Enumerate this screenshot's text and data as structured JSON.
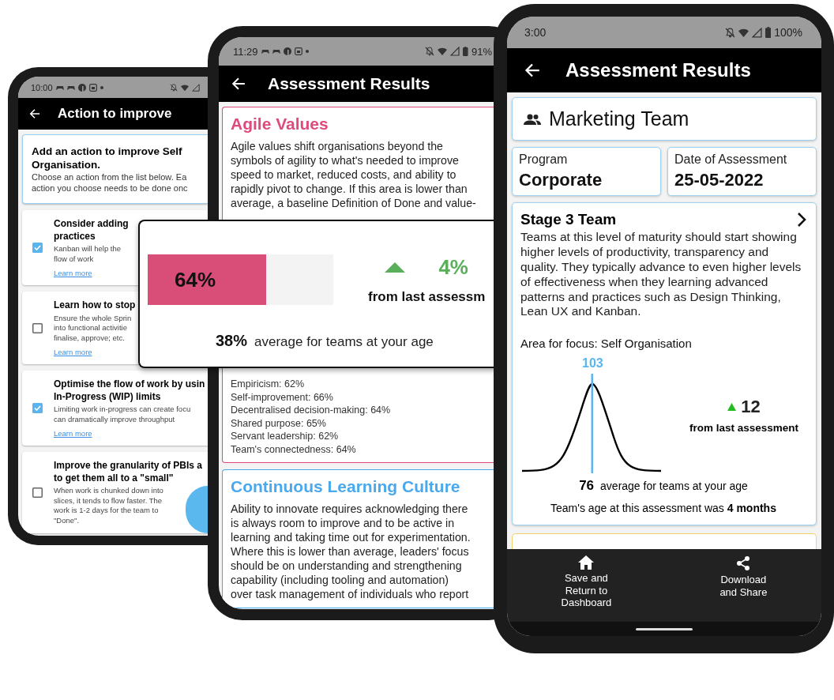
{
  "action_screen": {
    "status_bar": {
      "time": "10:00"
    },
    "title": "Action to improve",
    "intro": {
      "heading": "Add an action to improve Self\nOrganisation.",
      "text": "Choose an action from the list below. Ea\naction you choose needs to be done onc"
    },
    "actions": [
      {
        "title": "Consider adding\npractices",
        "text": "Kanban will help the\nflow of work",
        "link": "Learn more",
        "checked": true
      },
      {
        "title": "Learn how to stop",
        "text": "Ensure the whole Sprin\ninto functional activitie\nfinalise, approve; etc.",
        "link": "Learn more",
        "checked": false
      },
      {
        "title": "Optimise the flow of work by usin\nIn-Progress (WIP) limits",
        "text": "Limiting work in-progress can create focu\ncan dramatically improve throughput",
        "link": "Learn more",
        "checked": true
      },
      {
        "title": "Improve the granularity of PBIs a\nto get them all to a \"small\"",
        "text": "When work is chunked down into\nslices, it tends to flow faster. The\nwork is 1-2 days for the team to\n\"Done\".",
        "checked": false
      }
    ]
  },
  "results_screen": {
    "status_bar": {
      "time": "11:29",
      "battery": "91%"
    },
    "title": "Assessment Results",
    "sections": [
      {
        "title": "Agile Values",
        "color": "#de4b7b",
        "text": "Agile values shift organisations beyond the\nsymbols of agility to what's needed to improve\nspeed to market, reduced costs, and ability to\nrapidly pivot to change. If this area is lower than\naverage, a baseline Definition of Done and value-",
        "scores": [
          "Empiricism: 62%",
          "Self-improvement: 66%",
          "Decentralised decision-making: 64%",
          "Shared purpose: 65%",
          "Servant leadership: 62%",
          "Team's connectedness: 64%"
        ]
      },
      {
        "title": "Continuous Learning Culture",
        "color": "#4aa8ec",
        "text": "Ability to innovate requires acknowledging there\nis always room to improve and to be active in\nlearning and taking time out for experimentation.\nWhere this is lower than average, leaders' focus\nshould be on understanding and strengthening\ncapability (including tooling and automation)\nover task management of individuals who report"
      }
    ]
  },
  "score_popup": {
    "score": "64%",
    "level": 0.64,
    "change": "4%",
    "change_label": "from last assessm",
    "average": "38%",
    "average_label": "average for teams at your age"
  },
  "team_screen": {
    "status_bar": {
      "time": "3:00",
      "battery": "100%"
    },
    "title": "Assessment Results",
    "team": "Marketing Team",
    "details": [
      {
        "label": "Program",
        "value": "Corporate"
      },
      {
        "label": "Date of Assessment",
        "value": "25-05-2022"
      }
    ],
    "stage": {
      "title": "Stage 3 Team",
      "text": "Teams at this level of maturity should start showing higher levels of productivity, transparency and quality. They typically advance to even higher levels of effectiveness when they learning advanced patterns and practices such as Design Thinking, Lean UX and Kanban.",
      "focus": "Area for focus: Self Organisation",
      "marker": "103",
      "change": "12",
      "change_label": "from last assessment",
      "average": "76",
      "average_label": "average for teams at your age",
      "age_note": "Team's age at this assessment was **4 months**"
    },
    "nav": [
      {
        "kind": "home",
        "label": "Save and\nReturn to\nDashboard"
      },
      {
        "kind": "share",
        "label": "Download\nand Share"
      }
    ]
  }
}
